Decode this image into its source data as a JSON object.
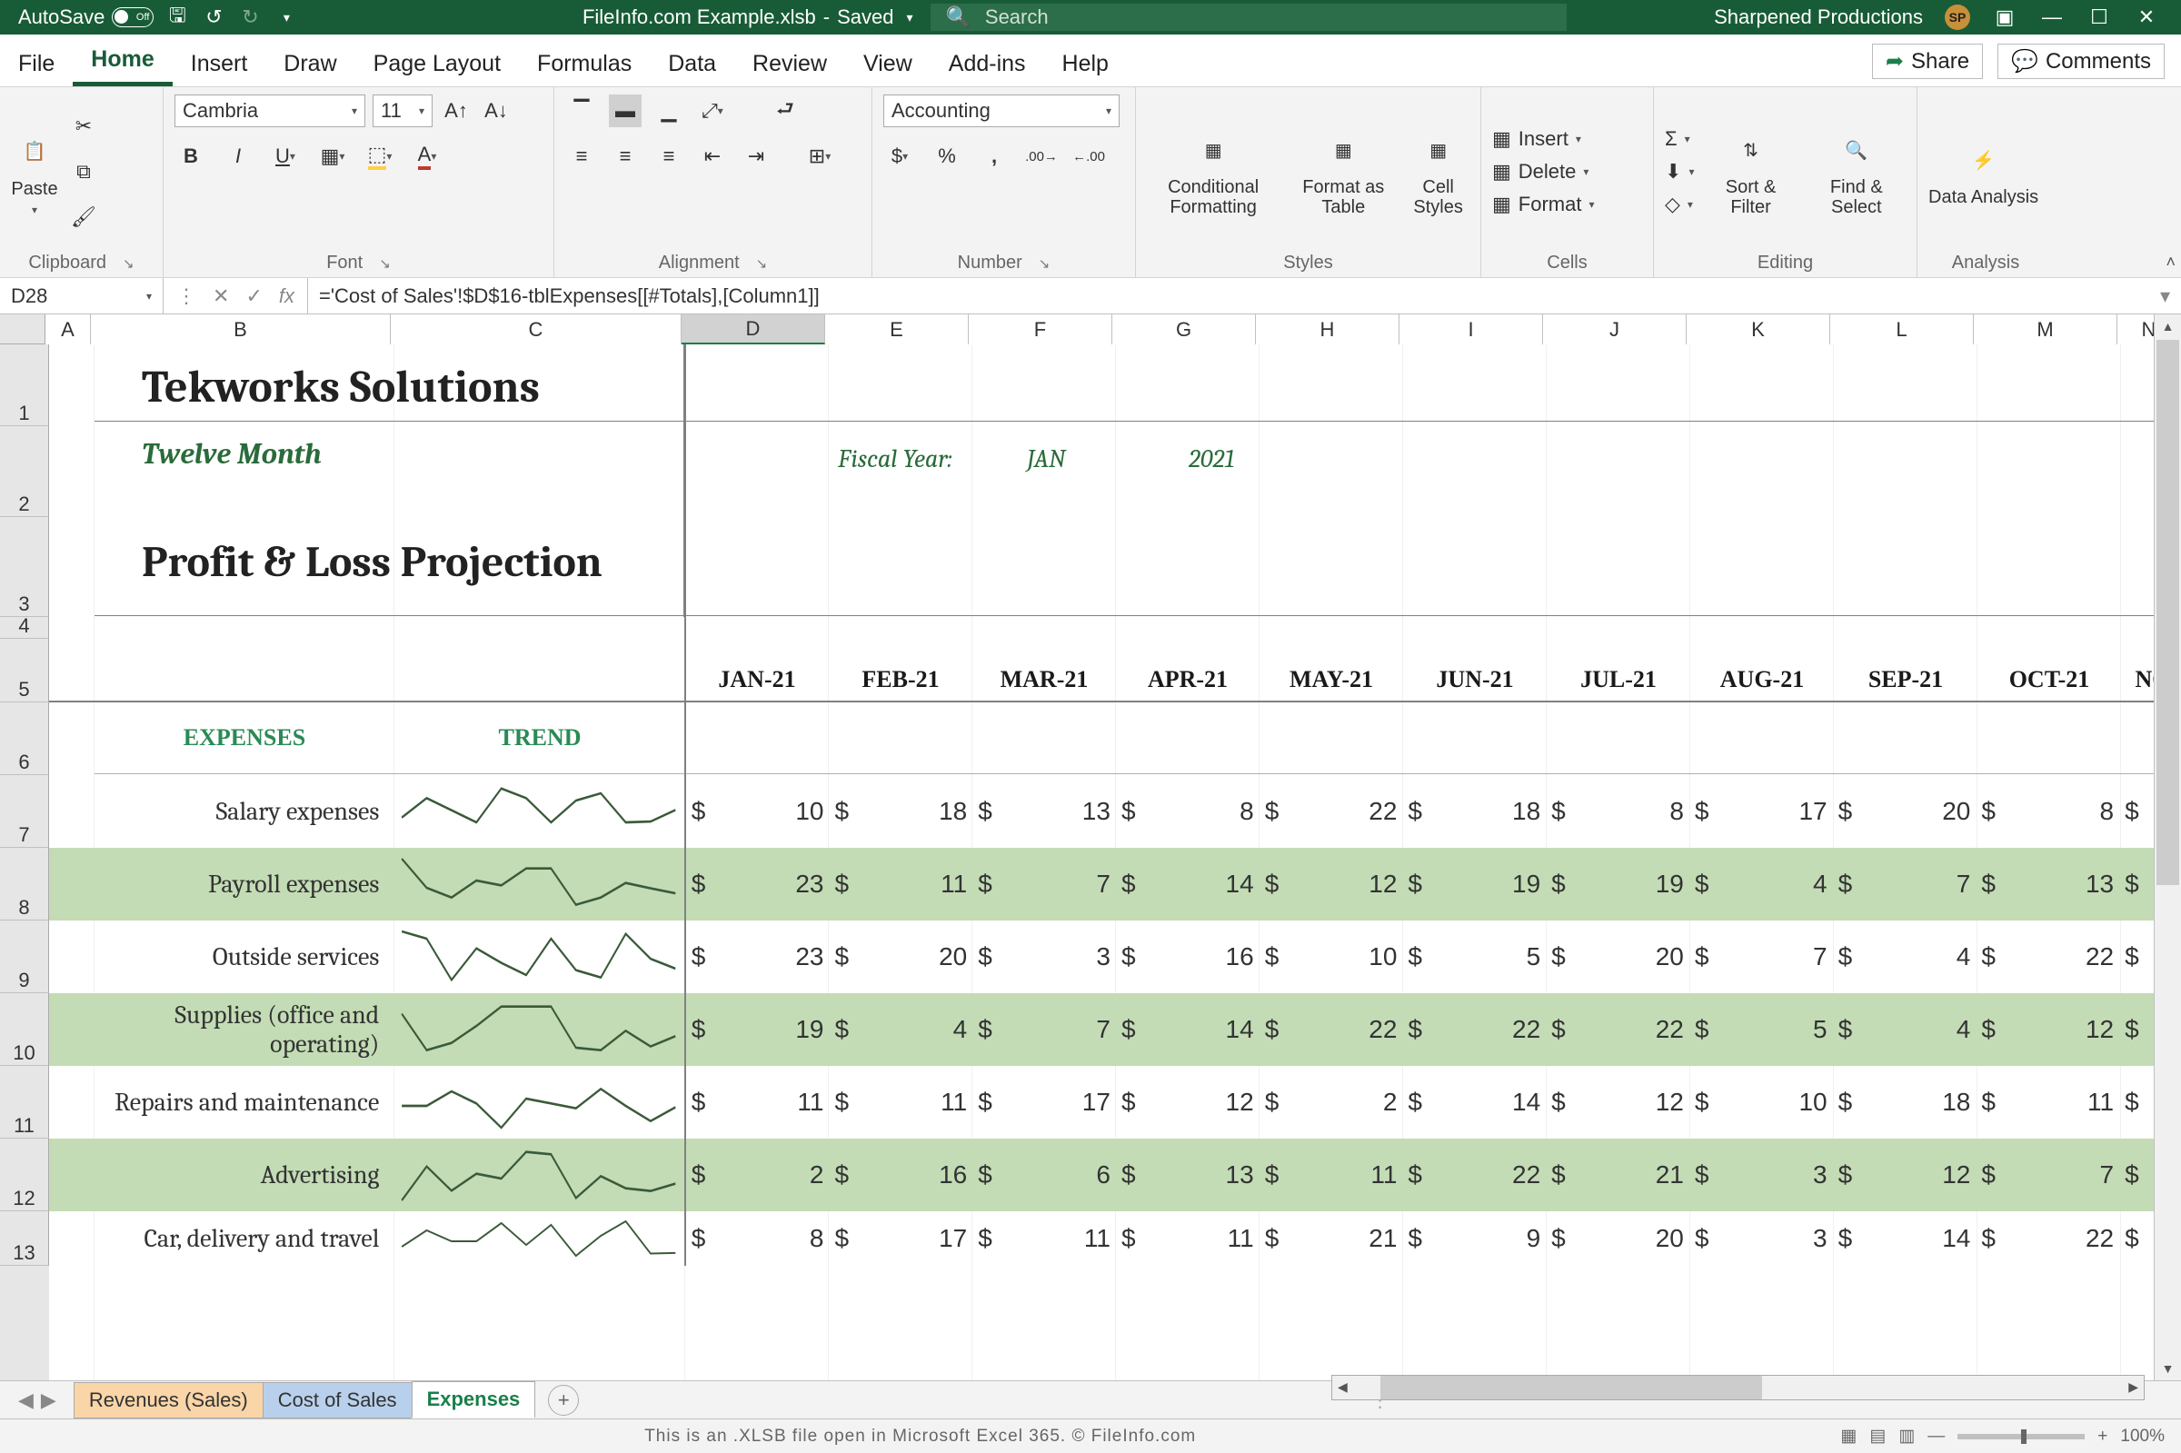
{
  "titlebar": {
    "autosave_label": "AutoSave",
    "autosave_state": "Off",
    "filename": "FileInfo.com Example.xlsb",
    "saved": "Saved",
    "search_placeholder": "Search",
    "account": "Sharpened Productions",
    "account_initials": "SP"
  },
  "tabs": {
    "file": "File",
    "home": "Home",
    "insert": "Insert",
    "draw": "Draw",
    "page_layout": "Page Layout",
    "formulas": "Formulas",
    "data": "Data",
    "review": "Review",
    "view": "View",
    "addins": "Add-ins",
    "help": "Help",
    "share": "Share",
    "comments": "Comments"
  },
  "ribbon": {
    "clipboard": {
      "paste": "Paste",
      "label": "Clipboard"
    },
    "font": {
      "name": "Cambria",
      "size": "11",
      "label": "Font"
    },
    "alignment": {
      "label": "Alignment"
    },
    "number": {
      "format": "Accounting",
      "label": "Number"
    },
    "styles": {
      "cond": "Conditional Formatting",
      "table": "Format as Table",
      "cell": "Cell Styles",
      "label": "Styles"
    },
    "cells": {
      "insert": "Insert",
      "delete": "Delete",
      "format": "Format",
      "label": "Cells"
    },
    "editing": {
      "sort": "Sort & Filter",
      "find": "Find & Select",
      "label": "Editing"
    },
    "analysis": {
      "data": "Data Analysis",
      "label": "Analysis"
    }
  },
  "formula_bar": {
    "cell_ref": "D28",
    "formula": "='Cost of Sales'!$D$16-tblExpenses[[#Totals],[Column1]]"
  },
  "columns": [
    "A",
    "B",
    "C",
    "D",
    "E",
    "F",
    "G",
    "H",
    "I",
    "J",
    "K",
    "L",
    "M",
    "N"
  ],
  "row_numbers": [
    "1",
    "2",
    "3",
    "4",
    "5",
    "6",
    "7",
    "8",
    "9",
    "10",
    "11",
    "12",
    "13"
  ],
  "doc": {
    "company": "Tekworks Solutions",
    "subtitle": "Twelve Month",
    "pl": "Profit & Loss Projection",
    "fiscal_label": "Fiscal Year:",
    "fiscal_month": "JAN",
    "fiscal_year": "2021",
    "months": [
      "JAN-21",
      "FEB-21",
      "MAR-21",
      "APR-21",
      "MAY-21",
      "JUN-21",
      "JUL-21",
      "AUG-21",
      "SEP-21",
      "OCT-21",
      "NO"
    ],
    "expenses_hdr": "EXPENSES",
    "trend_hdr": "TREND",
    "rows": [
      {
        "label": "Salary expenses",
        "vals": [
          "10",
          "18",
          "13",
          "8",
          "22",
          "18",
          "8",
          "17",
          "20",
          "8"
        ]
      },
      {
        "label": "Payroll expenses",
        "vals": [
          "23",
          "11",
          "7",
          "14",
          "12",
          "19",
          "19",
          "4",
          "7",
          "13"
        ]
      },
      {
        "label": "Outside services",
        "vals": [
          "23",
          "20",
          "3",
          "16",
          "10",
          "5",
          "20",
          "7",
          "4",
          "22"
        ]
      },
      {
        "label": "Supplies (office and operating)",
        "vals": [
          "19",
          "4",
          "7",
          "14",
          "22",
          "22",
          "22",
          "5",
          "4",
          "12"
        ]
      },
      {
        "label": "Repairs and maintenance",
        "vals": [
          "11",
          "11",
          "17",
          "12",
          "2",
          "14",
          "12",
          "10",
          "18",
          "11"
        ]
      },
      {
        "label": "Advertising",
        "vals": [
          "2",
          "16",
          "6",
          "13",
          "11",
          "22",
          "21",
          "3",
          "12",
          "7"
        ]
      },
      {
        "label": "Car, delivery and travel",
        "vals": [
          "8",
          "17",
          "11",
          "11",
          "21",
          "9",
          "20",
          "3",
          "14",
          "22"
        ]
      }
    ]
  },
  "sheet_tabs": {
    "rev": "Revenues (Sales)",
    "cos": "Cost of Sales",
    "exp": "Expenses"
  },
  "status": {
    "footer": "This is an .XLSB file open in Microsoft Excel 365. © FileInfo.com",
    "zoom": "100%"
  },
  "chart_data": {
    "type": "table",
    "title": "Profit & Loss Projection — Expenses",
    "columns": [
      "JAN-21",
      "FEB-21",
      "MAR-21",
      "APR-21",
      "MAY-21",
      "JUN-21",
      "JUL-21",
      "AUG-21",
      "SEP-21",
      "OCT-21"
    ],
    "series": [
      {
        "name": "Salary expenses",
        "values": [
          10,
          18,
          13,
          8,
          22,
          18,
          8,
          17,
          20,
          8
        ]
      },
      {
        "name": "Payroll expenses",
        "values": [
          23,
          11,
          7,
          14,
          12,
          19,
          19,
          4,
          7,
          13
        ]
      },
      {
        "name": "Outside services",
        "values": [
          23,
          20,
          3,
          16,
          10,
          5,
          20,
          7,
          4,
          22
        ]
      },
      {
        "name": "Supplies (office and operating)",
        "values": [
          19,
          4,
          7,
          14,
          22,
          22,
          22,
          5,
          4,
          12
        ]
      },
      {
        "name": "Repairs and maintenance",
        "values": [
          11,
          11,
          17,
          12,
          2,
          14,
          12,
          10,
          18,
          11
        ]
      },
      {
        "name": "Advertising",
        "values": [
          2,
          16,
          6,
          13,
          11,
          22,
          21,
          3,
          12,
          7
        ]
      },
      {
        "name": "Car, delivery and travel",
        "values": [
          8,
          17,
          11,
          11,
          21,
          9,
          20,
          3,
          14,
          22
        ]
      }
    ]
  }
}
